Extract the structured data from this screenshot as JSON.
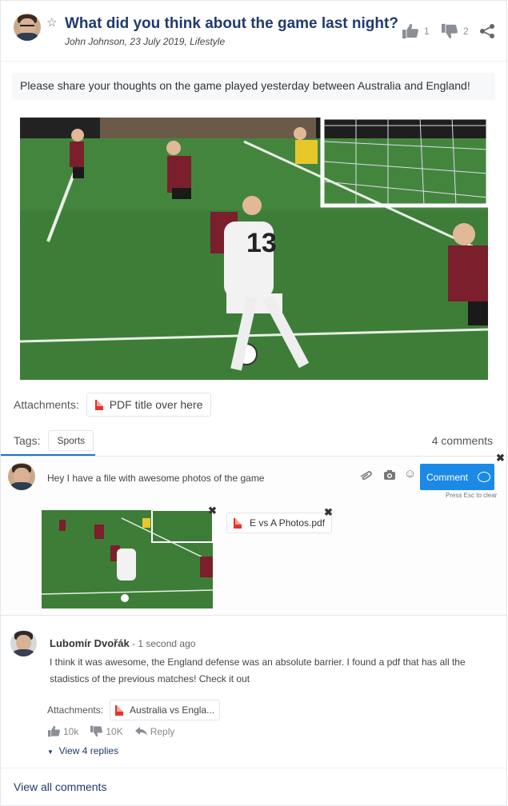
{
  "post": {
    "title": "What did you think about the game last night?",
    "meta": "John Johnson, 23 July 2019, Lifestyle",
    "likes": "1",
    "dislikes": "2",
    "body": "Please share your thoughts on the game played yesterday between Australia and England!",
    "attachments_label": "Attachments:",
    "attachment_title": "PDF title over here",
    "tags_label": "Tags:",
    "tags": [
      "Sports"
    ],
    "comment_count": "4 comments"
  },
  "composer": {
    "text": "Hey I have a file with awesome photos of the game",
    "button_label": "Comment",
    "hint": "Press Esc to clear",
    "file_name": "E vs A Photos.pdf"
  },
  "comment": {
    "author": "Lubomír Dvořák",
    "time": " - 1 second ago",
    "text": "I think it was awesome, the England defense was an absolute barrier. I found a pdf that has all the stadistics of the previous matches! Check it out",
    "attachments_label": "Attachments:",
    "attachment_title": "Australia vs Engla...",
    "likes": "10k",
    "dislikes": "10K",
    "reply_label": "Reply",
    "view_replies": "View 4 replies"
  },
  "footer": {
    "view_all": "View all comments"
  },
  "icons": [
    "star-icon",
    "thumbs-up-icon",
    "thumbs-down-icon",
    "share-icon",
    "pdf-icon",
    "paperclip-icon",
    "camera-icon",
    "smiley-icon",
    "speech-bubble-icon",
    "close-icon",
    "reply-icon",
    "caret-down-icon"
  ],
  "colors": {
    "title": "#1f3a6e",
    "accent": "#1a8ae6",
    "pdf": "#e5342a"
  }
}
